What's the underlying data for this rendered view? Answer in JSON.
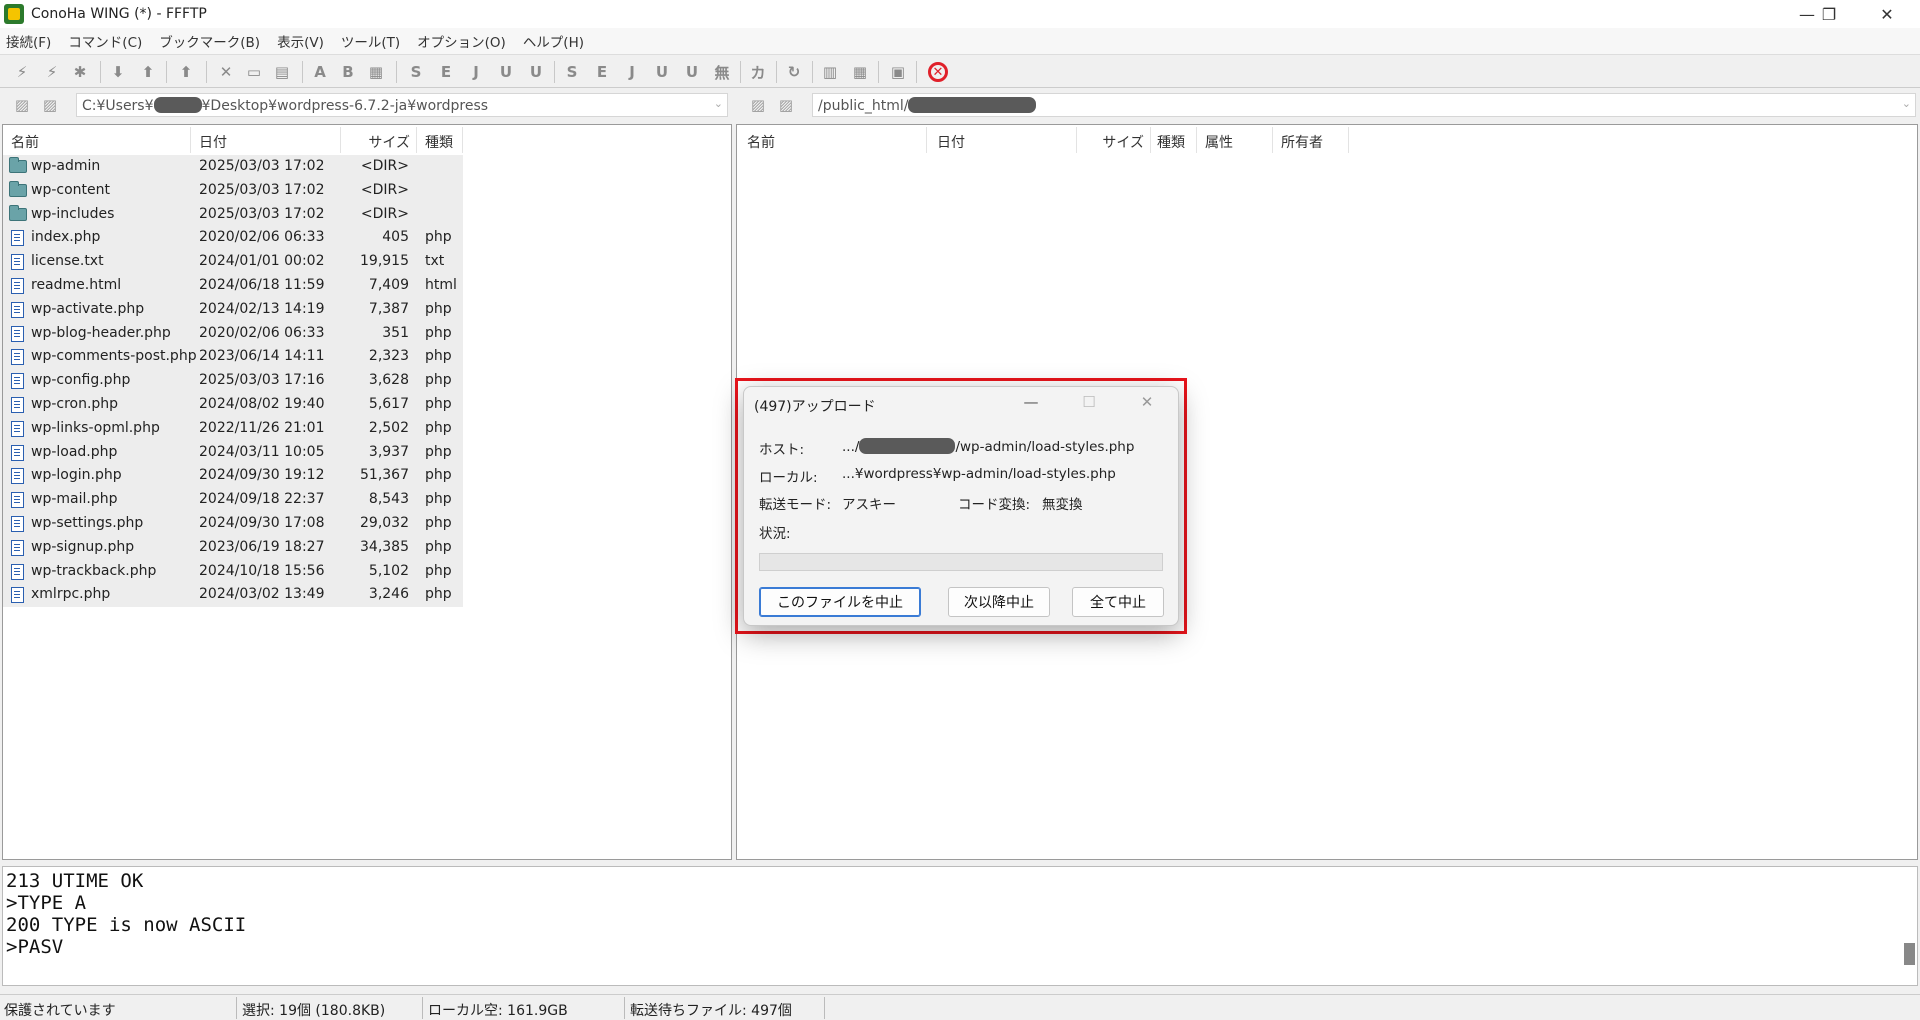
{
  "window": {
    "title": "ConoHa WING (*) - FFFTP",
    "minimize": "—",
    "maximize": "❐",
    "close": "✕"
  },
  "menu": [
    "接続(F)",
    "コマンド(C)",
    "ブックマーク(B)",
    "表示(V)",
    "ツール(T)",
    "オプション(O)",
    "ヘルプ(H)"
  ],
  "toolbar": {
    "icons": [
      "connect-icon",
      "quick-connect-icon",
      "disconnect-icon",
      "download-icon",
      "upload-icon",
      "parent-dir-icon",
      "delete-icon",
      "rename-icon",
      "mkdir-icon",
      "ascii-mode-icon",
      "binary-mode-icon",
      "auto-mode-icon",
      "sjis-icon",
      "euc-icon",
      "jis-icon",
      "utf8-icon",
      "utf8bom-icon",
      "remote-sjis-icon",
      "remote-euc-icon",
      "remote-jis-icon",
      "remote-utf8-icon",
      "remote-utf8bom-icon",
      "no-convert-icon",
      "kana-icon",
      "refresh-icon",
      "list-view-icon",
      "detail-view-icon",
      "sync-icon",
      "abort-icon"
    ]
  },
  "local": {
    "path_prefix": "C:¥Users¥",
    "path_suffix": "¥Desktop¥wordpress-6.7.2-ja¥wordpress",
    "columns": {
      "name": "名前",
      "date": "日付",
      "size": "サイズ",
      "type": "種類"
    },
    "files": [
      {
        "name": "wp-admin",
        "date": "2025/03/03 17:02",
        "size": "<DIR>",
        "type": "",
        "kind": "folder"
      },
      {
        "name": "wp-content",
        "date": "2025/03/03 17:02",
        "size": "<DIR>",
        "type": "",
        "kind": "folder"
      },
      {
        "name": "wp-includes",
        "date": "2025/03/03 17:02",
        "size": "<DIR>",
        "type": "",
        "kind": "folder"
      },
      {
        "name": "index.php",
        "date": "2020/02/06 06:33",
        "size": "405",
        "type": "php",
        "kind": "file"
      },
      {
        "name": "license.txt",
        "date": "2024/01/01 00:02",
        "size": "19,915",
        "type": "txt",
        "kind": "file"
      },
      {
        "name": "readme.html",
        "date": "2024/06/18 11:59",
        "size": "7,409",
        "type": "html",
        "kind": "file"
      },
      {
        "name": "wp-activate.php",
        "date": "2024/02/13 14:19",
        "size": "7,387",
        "type": "php",
        "kind": "file"
      },
      {
        "name": "wp-blog-header.php",
        "date": "2020/02/06 06:33",
        "size": "351",
        "type": "php",
        "kind": "file"
      },
      {
        "name": "wp-comments-post.php",
        "date": "2023/06/14 14:11",
        "size": "2,323",
        "type": "php",
        "kind": "file"
      },
      {
        "name": "wp-config.php",
        "date": "2025/03/03 17:16",
        "size": "3,628",
        "type": "php",
        "kind": "file"
      },
      {
        "name": "wp-cron.php",
        "date": "2024/08/02 19:40",
        "size": "5,617",
        "type": "php",
        "kind": "file"
      },
      {
        "name": "wp-links-opml.php",
        "date": "2022/11/26 21:01",
        "size": "2,502",
        "type": "php",
        "kind": "file"
      },
      {
        "name": "wp-load.php",
        "date": "2024/03/11 10:05",
        "size": "3,937",
        "type": "php",
        "kind": "file"
      },
      {
        "name": "wp-login.php",
        "date": "2024/09/30 19:12",
        "size": "51,367",
        "type": "php",
        "kind": "file"
      },
      {
        "name": "wp-mail.php",
        "date": "2024/09/18 22:37",
        "size": "8,543",
        "type": "php",
        "kind": "file"
      },
      {
        "name": "wp-settings.php",
        "date": "2024/09/30 17:08",
        "size": "29,032",
        "type": "php",
        "kind": "file"
      },
      {
        "name": "wp-signup.php",
        "date": "2023/06/19 18:27",
        "size": "34,385",
        "type": "php",
        "kind": "file"
      },
      {
        "name": "wp-trackback.php",
        "date": "2024/10/18 15:56",
        "size": "5,102",
        "type": "php",
        "kind": "file"
      },
      {
        "name": "xmlrpc.php",
        "date": "2024/03/02 13:49",
        "size": "3,246",
        "type": "php",
        "kind": "file"
      }
    ]
  },
  "remote": {
    "path_prefix": "/public_html/",
    "columns": {
      "name": "名前",
      "date": "日付",
      "size": "サイズ",
      "type": "種類",
      "attr": "属性",
      "owner": "所有者"
    }
  },
  "log": [
    "213 UTIME OK",
    ">TYPE A",
    "200 TYPE is now ASCII",
    ">PASV"
  ],
  "status": {
    "protect": "保護されています",
    "selection": "選択: 19個 (180.8KB)",
    "local_free": "ローカル空: 161.9GB",
    "queue": "転送待ちファイル: 497個"
  },
  "dialog": {
    "title": "(497)アップロード",
    "host_label": "ホスト:",
    "host_prefix": ".../",
    "host_suffix": "/wp-admin/load-styles.php",
    "local_label": "ローカル:",
    "local_value": "...¥wordpress¥wp-admin/load-styles.php",
    "mode_label": "転送モード:",
    "mode_value": "アスキー",
    "conv_label": "コード変換:",
    "conv_value": "無変換",
    "status_label": "状況:",
    "progress": 0,
    "btn_stop_file": "このファイルを中止",
    "btn_stop_after": "次以降中止",
    "btn_stop_all": "全て中止"
  },
  "colors": {
    "highlight": "#e8141b",
    "folder": "#6aa3a8",
    "file": "#2a5fb0",
    "abort": "#e0202a"
  }
}
